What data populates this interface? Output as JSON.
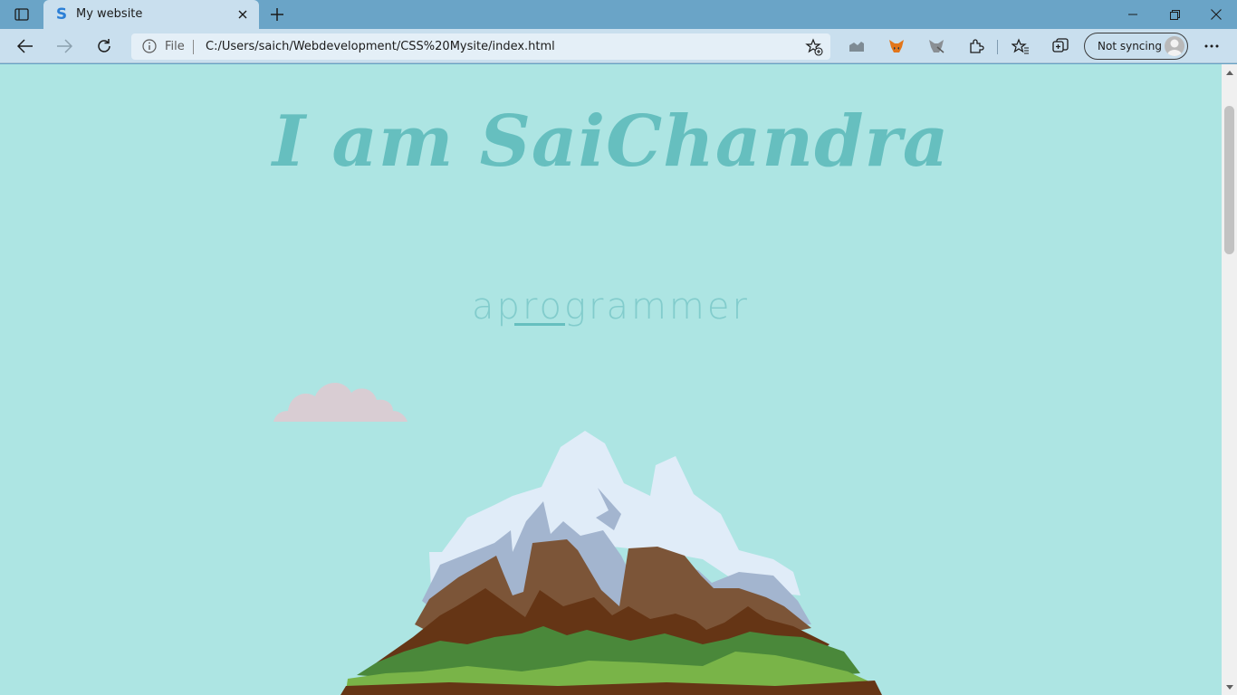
{
  "browser": {
    "tab_title": "My website",
    "address": {
      "scheme_label": "File",
      "url": "C:/Users/saich/Webdevelopment/CSS%20Mysite/index.html"
    },
    "profile_label": "Not syncing"
  },
  "page": {
    "heading": "I am SaiChandra",
    "subtitle": "aprogrammer",
    "background_color": "#ade5e3",
    "accent_color": "#66bfbf"
  },
  "icons": [
    "tab-actions-icon",
    "favicon-icon",
    "tab-close-icon",
    "new-tab-icon",
    "minimize-icon",
    "restore-icon",
    "window-close-icon",
    "back-icon",
    "forward-icon",
    "refresh-icon",
    "info-icon",
    "add-favorite-icon",
    "extension-icon",
    "metamask-icon",
    "extension-fox-icon",
    "puzzle-icon",
    "favorites-icon",
    "collections-icon",
    "avatar-icon",
    "more-icon"
  ]
}
